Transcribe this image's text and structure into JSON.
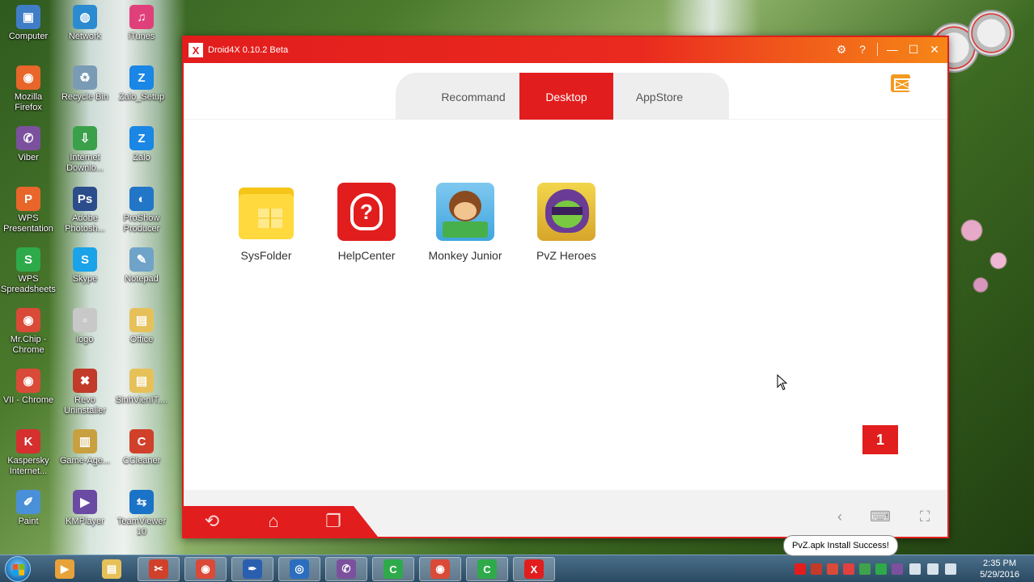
{
  "desktop": {
    "icons": [
      {
        "label": "Computer",
        "color": "#3f7dc7",
        "glyph": "▣"
      },
      {
        "label": "Network",
        "color": "#2a8bd1",
        "glyph": "◍"
      },
      {
        "label": "iTunes",
        "color": "#e0407a",
        "glyph": "♫"
      },
      {
        "label": "Mozilla Firefox",
        "color": "#e8662a",
        "glyph": "◉"
      },
      {
        "label": "Recycle Bin",
        "color": "#7a9bb5",
        "glyph": "♻"
      },
      {
        "label": "Zalo_Setup",
        "color": "#1a86e5",
        "glyph": "Z"
      },
      {
        "label": "Viber",
        "color": "#7b519d",
        "glyph": "✆"
      },
      {
        "label": "Internet Downlo...",
        "color": "#3aa14a",
        "glyph": "⇩"
      },
      {
        "label": "Zalo",
        "color": "#1a86e5",
        "glyph": "Z"
      },
      {
        "label": "WPS Presentation",
        "color": "#e8662a",
        "glyph": "P"
      },
      {
        "label": "Adobe Photosh...",
        "color": "#2b4d8c",
        "glyph": "Ps"
      },
      {
        "label": "ProShow Producer",
        "color": "#2176c7",
        "glyph": "◐"
      },
      {
        "label": "WPS Spreadsheets",
        "color": "#2eaa4a",
        "glyph": "S"
      },
      {
        "label": "Skype",
        "color": "#1aa3e8",
        "glyph": "S"
      },
      {
        "label": "Notepad",
        "color": "#6fa3c8",
        "glyph": "✎"
      },
      {
        "label": "Mr.Chip - Chrome",
        "color": "#d94a38",
        "glyph": "◉"
      },
      {
        "label": "logo",
        "color": "#c8c8c8",
        "glyph": "▫"
      },
      {
        "label": "Office",
        "color": "#e6c15a",
        "glyph": "▤"
      },
      {
        "label": "VII - Chrome",
        "color": "#d94a38",
        "glyph": "◉"
      },
      {
        "label": "Revo Uninstaller",
        "color": "#c23a2a",
        "glyph": "✖"
      },
      {
        "label": "SinhVienIT....",
        "color": "#e6c15a",
        "glyph": "▤"
      },
      {
        "label": "Kaspersky Internet...",
        "color": "#d62f2f",
        "glyph": "K"
      },
      {
        "label": "Game-Age...",
        "color": "#c9a040",
        "glyph": "▥"
      },
      {
        "label": "CCleaner",
        "color": "#d0402a",
        "glyph": "C"
      },
      {
        "label": "Paint",
        "color": "#4a90d9",
        "glyph": "✐"
      },
      {
        "label": "KMPlayer",
        "color": "#6b4aa3",
        "glyph": "▶"
      },
      {
        "label": "TeamViewer 10",
        "color": "#1a73c7",
        "glyph": "⇆"
      }
    ]
  },
  "window": {
    "title": "Droid4X 0.10.2 Beta",
    "logo_glyph": "X",
    "titlebar_buttons": {
      "settings": "⚙",
      "help": "?",
      "minimize": "—",
      "maximize": "☐",
      "close": "✕"
    }
  },
  "tabs": [
    {
      "label": "Recommand",
      "active": false
    },
    {
      "label": "Desktop",
      "active": true
    },
    {
      "label": "AppStore",
      "active": false
    }
  ],
  "apps": [
    {
      "label": "SysFolder",
      "icon": "folder-icon"
    },
    {
      "label": "HelpCenter",
      "icon": "help-bulb-icon",
      "glyph": "?"
    },
    {
      "label": "Monkey Junior",
      "icon": "monkey-icon"
    },
    {
      "label": "PvZ Heroes",
      "icon": "pvz-icon"
    }
  ],
  "page_indicator": "1",
  "navbar": {
    "back": "⟲",
    "home": "⌂",
    "recents": "❐",
    "left_arrow": "‹",
    "keyboard": "⌨",
    "fullscreen": "⛶"
  },
  "toast": "PvZ.apk Install Success!",
  "taskbar": {
    "apps": [
      {
        "color": "#e8a23a",
        "glyph": "▶"
      },
      {
        "color": "#e6c15a",
        "glyph": "▤"
      },
      {
        "color": "#d0402a",
        "glyph": "✂"
      },
      {
        "color": "#d94a38",
        "glyph": "◉"
      },
      {
        "color": "#2a5fb0",
        "glyph": "✒"
      },
      {
        "color": "#2b6dbf",
        "glyph": "◎"
      },
      {
        "color": "#7b519d",
        "glyph": "✆"
      },
      {
        "color": "#2eaa4a",
        "glyph": "C"
      },
      {
        "color": "#d94a38",
        "glyph": "◉"
      },
      {
        "color": "#2eaa4a",
        "glyph": "C"
      },
      {
        "color": "#e21d1d",
        "glyph": "X"
      }
    ],
    "clock_time": "2:35 PM",
    "clock_date": "5/29/2016"
  }
}
